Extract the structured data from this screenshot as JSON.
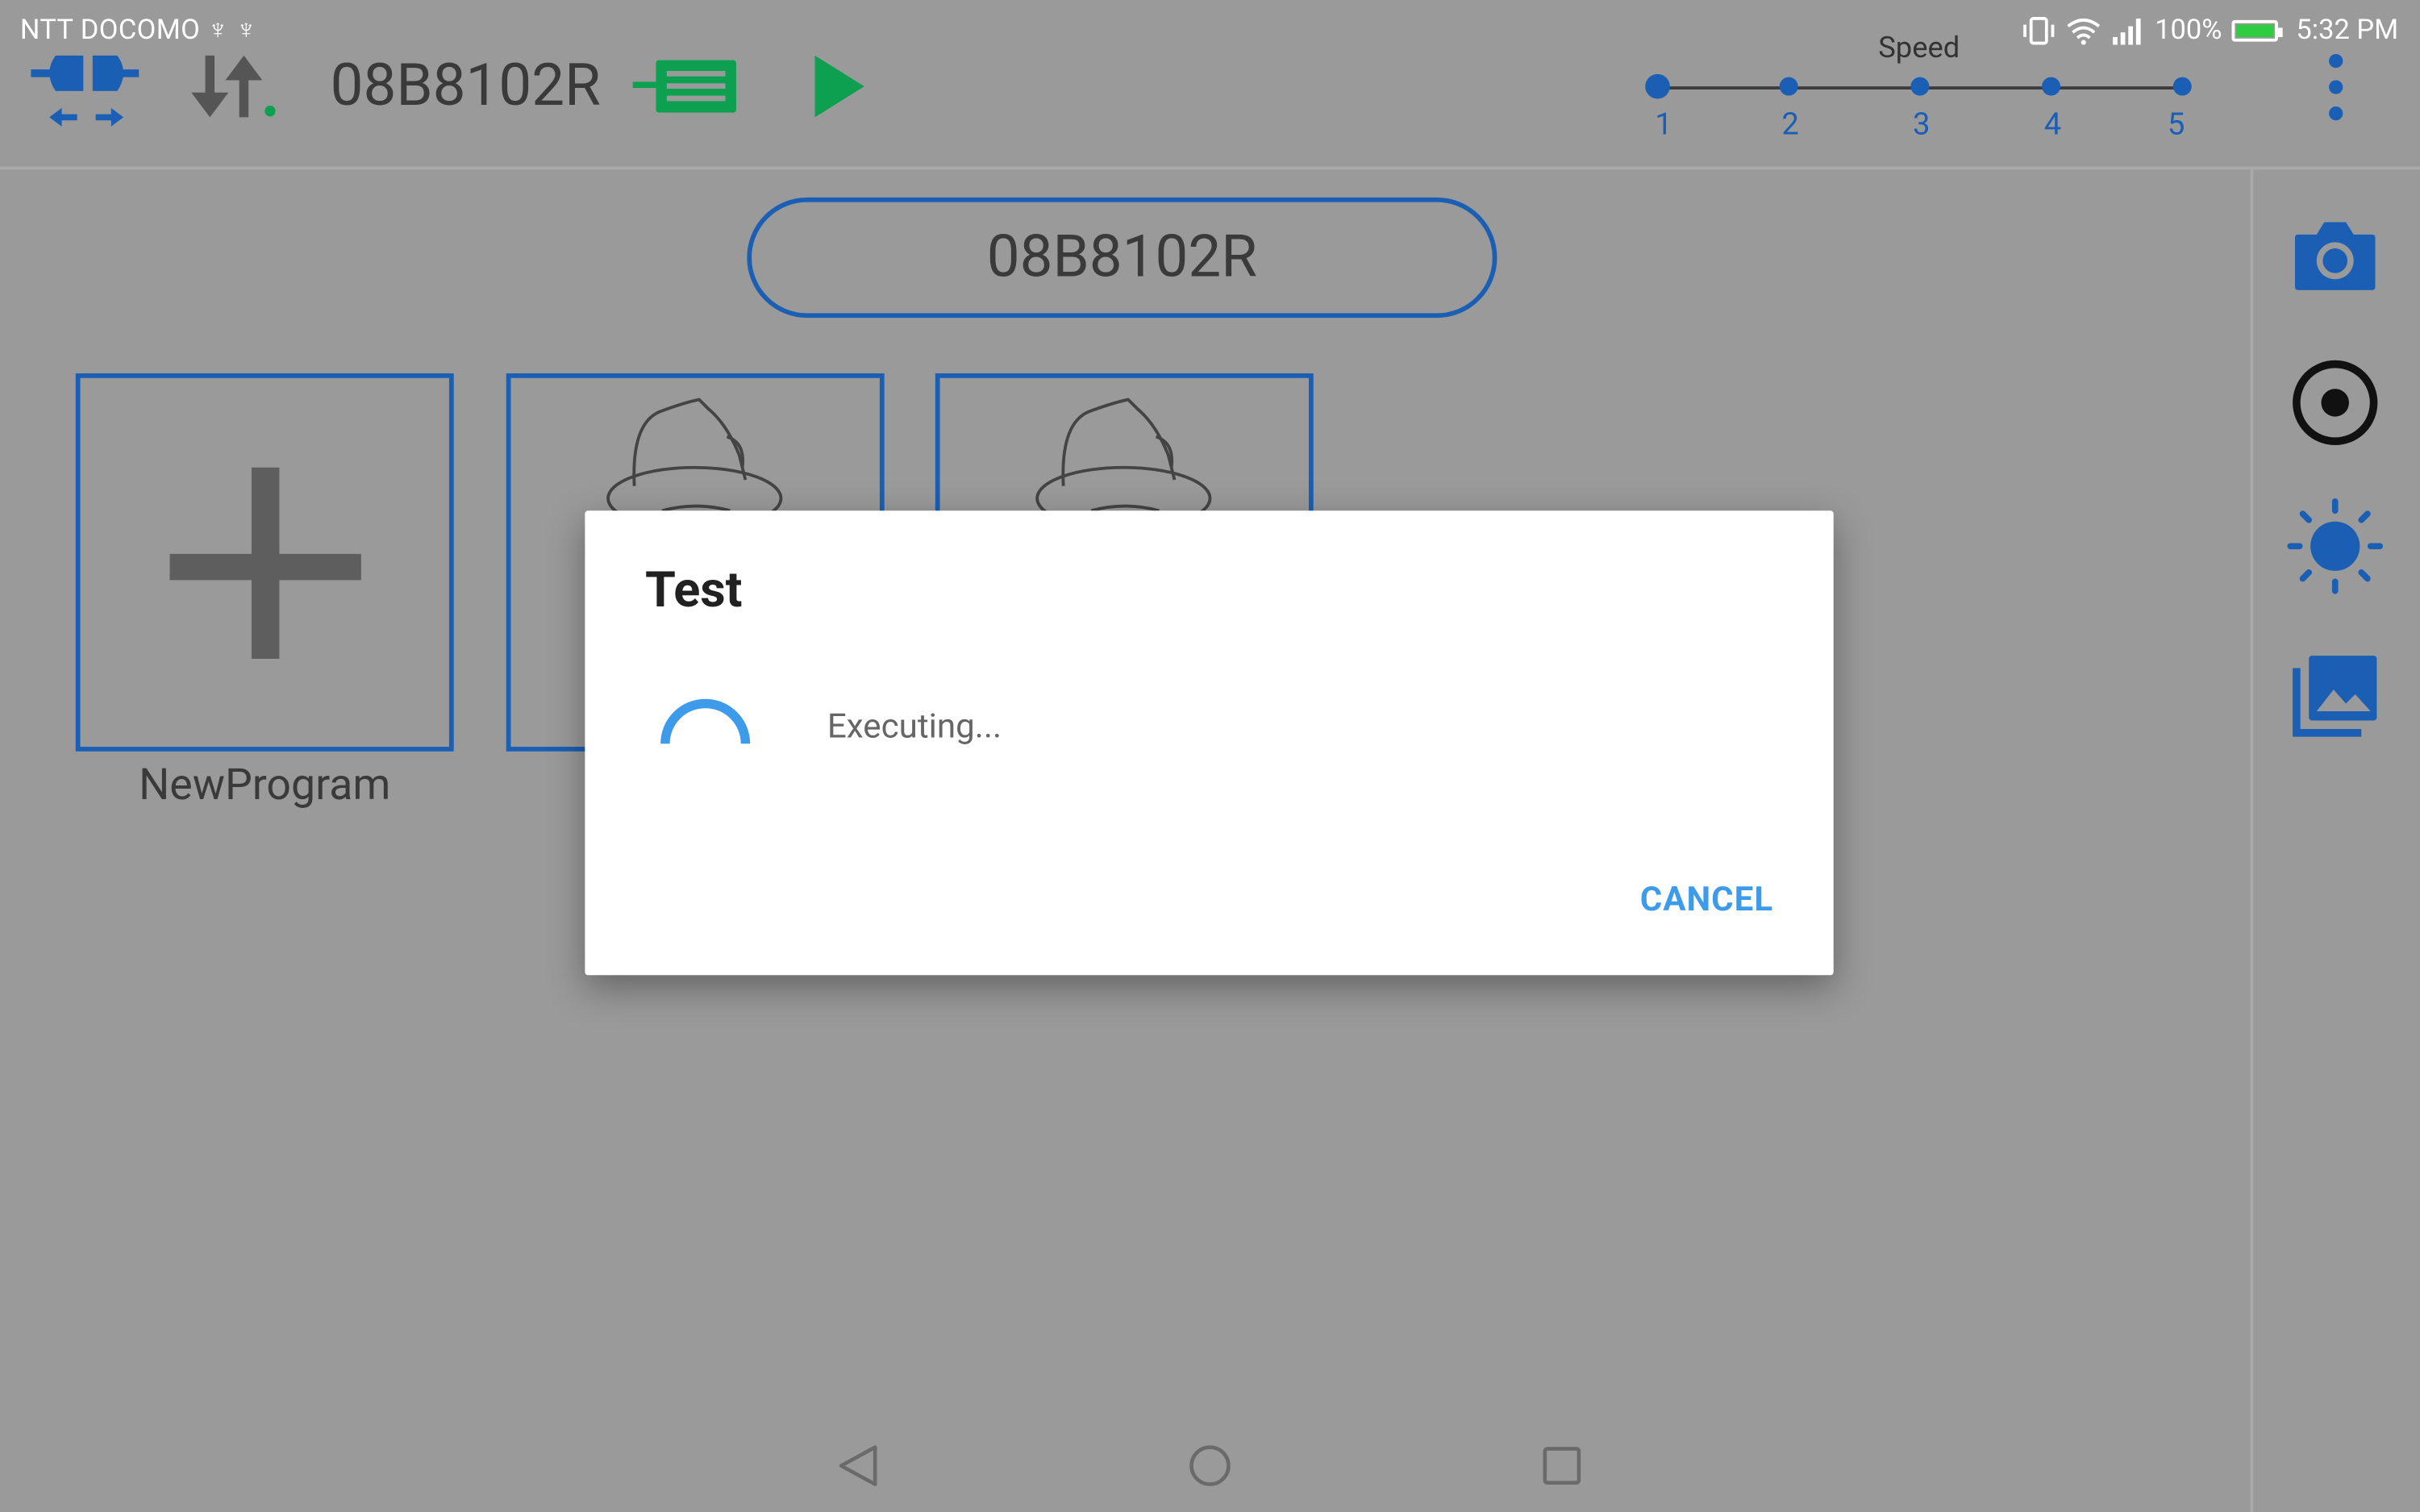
{
  "status_bar": {
    "carrier": "NTT DOCOMO ♆ ♆",
    "battery": "100%",
    "time": "5:32 PM"
  },
  "toolbar": {
    "connect_icon": "bluetooth-connect-icon",
    "transfer_icon": "up-down-transfer-icon",
    "device_id": "08B8102R",
    "program_list_icon": "program-list-icon",
    "run_icon": "play-icon",
    "speed": {
      "label": "Speed",
      "levels": [
        "1",
        "2",
        "3",
        "4",
        "5"
      ],
      "selected": 1
    }
  },
  "main": {
    "program_name": "08B8102R",
    "tiles": [
      {
        "label": "NewProgram",
        "icon": "plus-icon"
      },
      {
        "label": "",
        "icon": "robot-hat-icon"
      },
      {
        "label": "",
        "icon": "robot-hat-icon"
      }
    ]
  },
  "sidebar": {
    "icons": [
      "camera-icon",
      "record-icon",
      "brightness-icon",
      "gallery-icon"
    ]
  },
  "dialog": {
    "title": "Test",
    "message": "Executing...",
    "cancel_label": "CANCEL"
  },
  "nav_bar": {
    "icons": [
      "back-icon",
      "home-icon",
      "recents-icon"
    ]
  },
  "colors": {
    "accent_blue": "#1a5fb4",
    "dialog_button": "#3d9be9",
    "green": "#0ca050",
    "background": "#9a9a9a"
  }
}
